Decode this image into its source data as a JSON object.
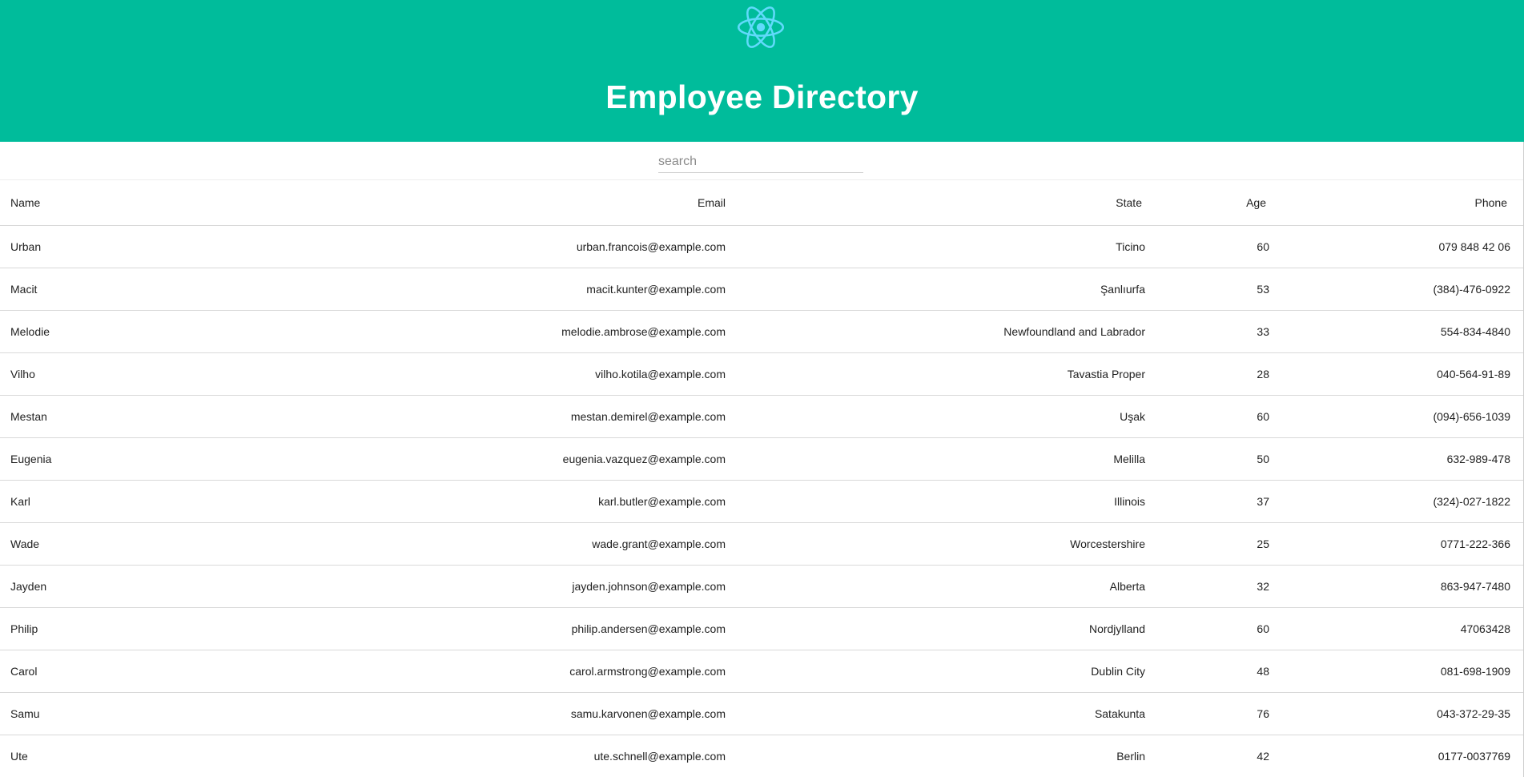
{
  "header": {
    "logo_icon": "react-atom-icon",
    "title": "Employee Directory",
    "background_color": "#00bc9b",
    "logo_color": "#61dafb"
  },
  "search": {
    "placeholder": "search",
    "value": ""
  },
  "table": {
    "columns": [
      "Name",
      "Email",
      "State",
      "Age",
      "Phone"
    ],
    "rows": [
      {
        "name": "Urban",
        "email": "urban.francois@example.com",
        "state": "Ticino",
        "age": "60",
        "phone": "079 848 42 06"
      },
      {
        "name": "Macit",
        "email": "macit.kunter@example.com",
        "state": "Şanlıurfa",
        "age": "53",
        "phone": "(384)-476-0922"
      },
      {
        "name": "Melodie",
        "email": "melodie.ambrose@example.com",
        "state": "Newfoundland and Labrador",
        "age": "33",
        "phone": "554-834-4840"
      },
      {
        "name": "Vilho",
        "email": "vilho.kotila@example.com",
        "state": "Tavastia Proper",
        "age": "28",
        "phone": "040-564-91-89"
      },
      {
        "name": "Mestan",
        "email": "mestan.demirel@example.com",
        "state": "Uşak",
        "age": "60",
        "phone": "(094)-656-1039"
      },
      {
        "name": "Eugenia",
        "email": "eugenia.vazquez@example.com",
        "state": "Melilla",
        "age": "50",
        "phone": "632-989-478"
      },
      {
        "name": "Karl",
        "email": "karl.butler@example.com",
        "state": "Illinois",
        "age": "37",
        "phone": "(324)-027-1822"
      },
      {
        "name": "Wade",
        "email": "wade.grant@example.com",
        "state": "Worcestershire",
        "age": "25",
        "phone": "0771-222-366"
      },
      {
        "name": "Jayden",
        "email": "jayden.johnson@example.com",
        "state": "Alberta",
        "age": "32",
        "phone": "863-947-7480"
      },
      {
        "name": "Philip",
        "email": "philip.andersen@example.com",
        "state": "Nordjylland",
        "age": "60",
        "phone": "47063428"
      },
      {
        "name": "Carol",
        "email": "carol.armstrong@example.com",
        "state": "Dublin City",
        "age": "48",
        "phone": "081-698-1909"
      },
      {
        "name": "Samu",
        "email": "samu.karvonen@example.com",
        "state": "Satakunta",
        "age": "76",
        "phone": "043-372-29-35"
      },
      {
        "name": "Ute",
        "email": "ute.schnell@example.com",
        "state": "Berlin",
        "age": "42",
        "phone": "0177-0037769"
      }
    ]
  }
}
